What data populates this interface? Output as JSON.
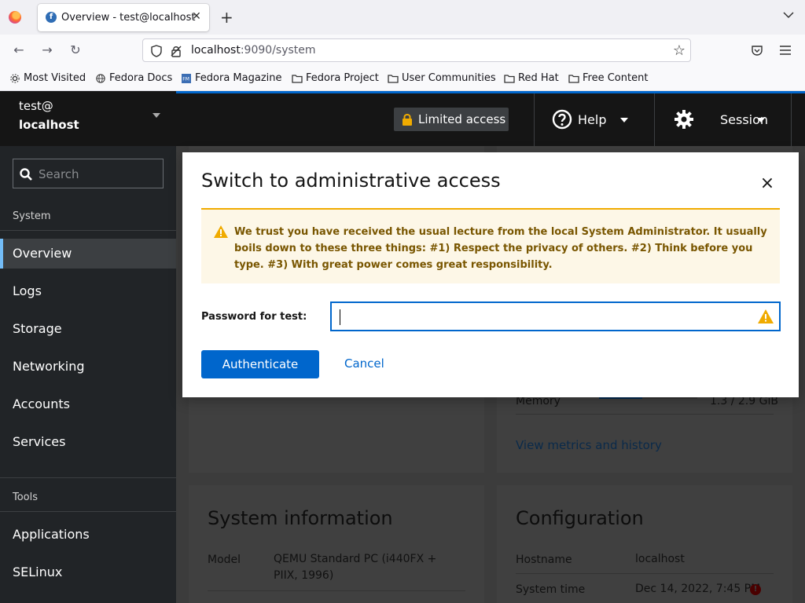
{
  "browser": {
    "tab_title": "Overview - test@localhost",
    "url_host": "localhost",
    "url_rest": ":9090/system",
    "bookmarks": [
      {
        "label": "Most Visited",
        "icon": "gear-icon"
      },
      {
        "label": "Fedora Docs",
        "icon": "globe-icon"
      },
      {
        "label": "Fedora Magazine",
        "icon": "fm-icon"
      },
      {
        "label": "Fedora Project",
        "icon": "folder-icon"
      },
      {
        "label": "User Communities",
        "icon": "folder-icon"
      },
      {
        "label": "Red Hat",
        "icon": "folder-icon"
      },
      {
        "label": "Free Content",
        "icon": "folder-icon"
      }
    ]
  },
  "host": {
    "user": "test@",
    "name": "localhost"
  },
  "sidebar": {
    "search_placeholder": "Search",
    "system_label": "System",
    "items": [
      {
        "label": "Overview"
      },
      {
        "label": "Logs"
      },
      {
        "label": "Storage"
      },
      {
        "label": "Networking"
      },
      {
        "label": "Accounts"
      },
      {
        "label": "Services"
      }
    ],
    "tools_label": "Tools",
    "tools": [
      {
        "label": "Applications"
      },
      {
        "label": "SELinux"
      }
    ]
  },
  "masthead": {
    "limited_access": "Limited access",
    "help": "Help",
    "session": "Session"
  },
  "background": {
    "memory_label": "Memory",
    "memory_value": "1.3 / 2.9 GiB",
    "memory_fraction": 0.44,
    "metrics_link": "View metrics and history",
    "sysinfo_title": "System information",
    "model_label": "Model",
    "model_value": "QEMU Standard PC (i440FX + PIIX, 1996)",
    "config_title": "Configuration",
    "hostname_label": "Hostname",
    "hostname_value": "localhost",
    "systime_label": "System time",
    "systime_value": "Dec 14, 2022, 7:45 PM"
  },
  "modal": {
    "title": "Switch to administrative access",
    "alert": "We trust you have received the usual lecture from the local System Administrator. It usually boils down to these three things: #1) Respect the privacy of others. #2) Think before you type. #3) With great power comes great responsibility.",
    "password_label": "Password for test:",
    "password_value": "",
    "authenticate": "Authenticate",
    "cancel": "Cancel"
  },
  "colors": {
    "accent": "#0066cc",
    "warning": "#f0ab00",
    "sidebar_bg": "#212427"
  }
}
